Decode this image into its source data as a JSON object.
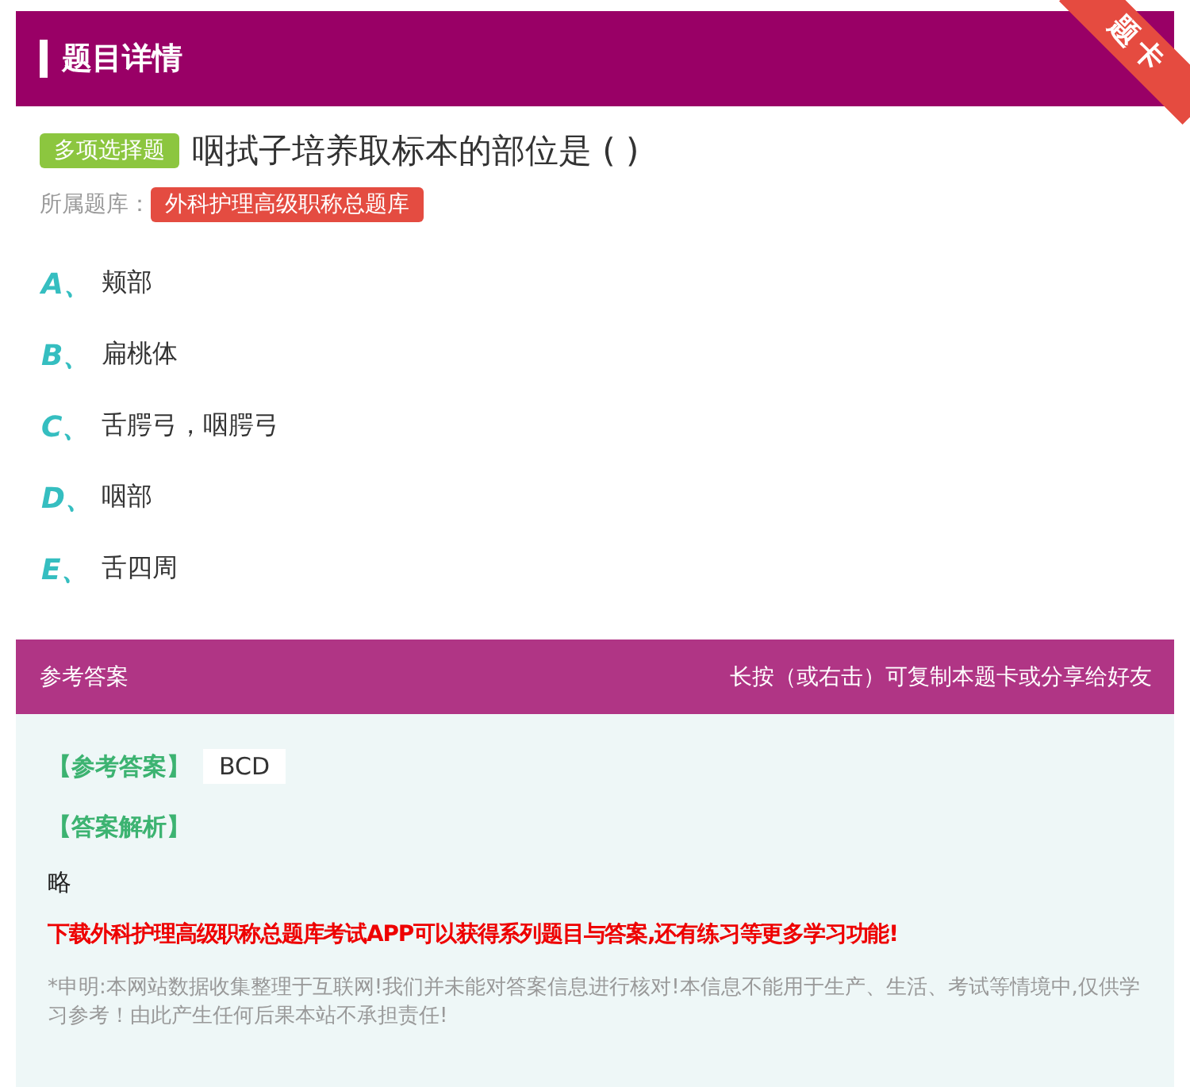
{
  "header": {
    "title": "题目详情",
    "ribbon": "题卡"
  },
  "question": {
    "type_badge": "多项选择题",
    "text": "咽拭子培养取标本的部位是 ( )",
    "bank_label": "所属题库：",
    "bank": "外科护理高级职称总题库"
  },
  "options": [
    {
      "letter": "A、",
      "text": "颊部"
    },
    {
      "letter": "B、",
      "text": "扁桃体"
    },
    {
      "letter": "C、",
      "text": "舌腭弓，咽腭弓"
    },
    {
      "letter": "D、",
      "text": "咽部"
    },
    {
      "letter": "E、",
      "text": "舌四周"
    }
  ],
  "answer": {
    "title": "参考答案",
    "hint": "长按（或右击）可复制本题卡或分享给好友",
    "answer_label": "【参考答案】",
    "answer_value": "BCD",
    "analysis_label": "【答案解析】",
    "analysis": "略",
    "promo": "下载外科护理高级职称总题库考试APP可以获得系列题目与答案,还有练习等更多学习功能!",
    "disclaimer": "*申明:本网站数据收集整理于互联网!我们并未能对答案信息进行核对!本信息不能用于生产、生活、考试等情境中,仅供学习参考！由此产生任何后果本站不承担责任!"
  }
}
